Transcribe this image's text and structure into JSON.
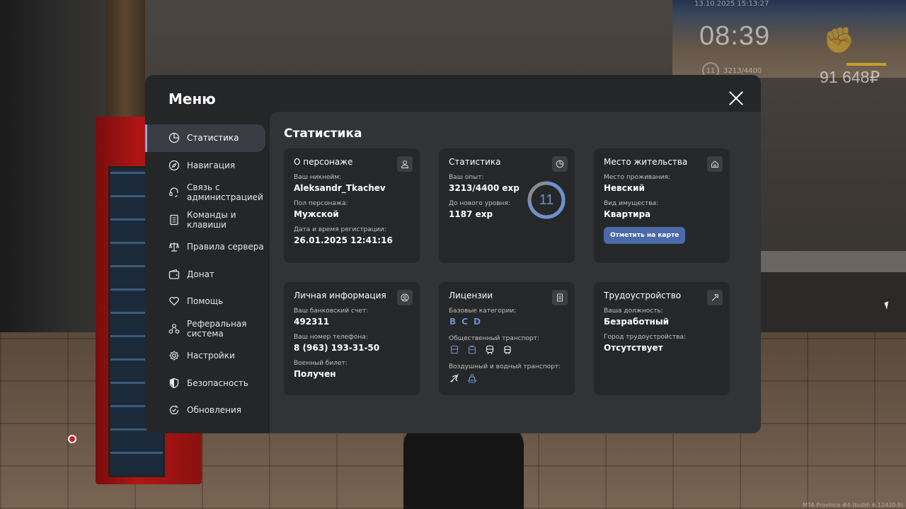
{
  "hud": {
    "datetime": "13.10.2025 15:13:27",
    "time": "08:39",
    "level": "11",
    "exp": "3213/4400",
    "money": "91 648₽",
    "build": "MTA Province #4 (build: 6.12420.9)"
  },
  "menu": {
    "title": "Меню",
    "close_icon": "close-icon"
  },
  "sidebar": {
    "items": [
      {
        "label": "Статистика",
        "icon": "pie-chart-icon",
        "active": true
      },
      {
        "label": "Навигация",
        "icon": "compass-icon"
      },
      {
        "label": "Связь с администрацией",
        "icon": "headset-icon"
      },
      {
        "label": "Команды и клавиши",
        "icon": "document-icon"
      },
      {
        "label": "Правила сервера",
        "icon": "scales-icon"
      },
      {
        "label": "Донат",
        "icon": "wallet-icon"
      },
      {
        "label": "Помощь",
        "icon": "heart-hand-icon"
      },
      {
        "label": "Реферальная система",
        "icon": "network-icon"
      },
      {
        "label": "Настройки",
        "icon": "gear-icon"
      },
      {
        "label": "Безопасность",
        "icon": "shield-icon"
      },
      {
        "label": "Обновления",
        "icon": "refresh-check-icon"
      }
    ]
  },
  "content": {
    "title": "Статистика",
    "character": {
      "title": "О персонаже",
      "nickname_label": "Ваш никнейм:",
      "nickname": "Aleksandr_Tkachev",
      "gender_label": "Пол персонажа:",
      "gender": "Мужской",
      "reg_label": "Дата и время регистрации:",
      "reg_date": "26.01.2025 12:41:16"
    },
    "stats": {
      "title": "Статистика",
      "exp_label": "Ваш опыт:",
      "exp": "3213/4400 exp",
      "next_label": "До нового уровня:",
      "next": "1187 exp",
      "level": "11",
      "progress": 0.73
    },
    "residence": {
      "title": "Место жительства",
      "place_label": "Место проживания:",
      "place": "Невский",
      "type_label": "Вид имущества:",
      "type": "Квартира",
      "map_button": "Отметить на карте"
    },
    "personal": {
      "title": "Личная информация",
      "bank_label": "Ваш банковский счет:",
      "bank": "492311",
      "phone_label": "Ваш номер телефона:",
      "phone": "8 (963) 193-31-50",
      "military_label": "Военный билет:",
      "military": "Получен"
    },
    "licenses": {
      "title": "Лицензии",
      "base_label": "Базовые категории:",
      "categories": [
        "B",
        "C",
        "D"
      ],
      "public_label": "Общественный транспорт:",
      "air_water_label": "Воздушный и водный транспорт:"
    },
    "employment": {
      "title": "Трудоустройство",
      "position_label": "Ваша должность:",
      "position": "Безработный",
      "city_label": "Город трудоустройства:",
      "city": "Отсутствует"
    }
  },
  "colors": {
    "accent": "#6f8fcf",
    "button": "#4a6aa8",
    "panel": "#252628",
    "content": "#323335",
    "card": "#262729"
  }
}
